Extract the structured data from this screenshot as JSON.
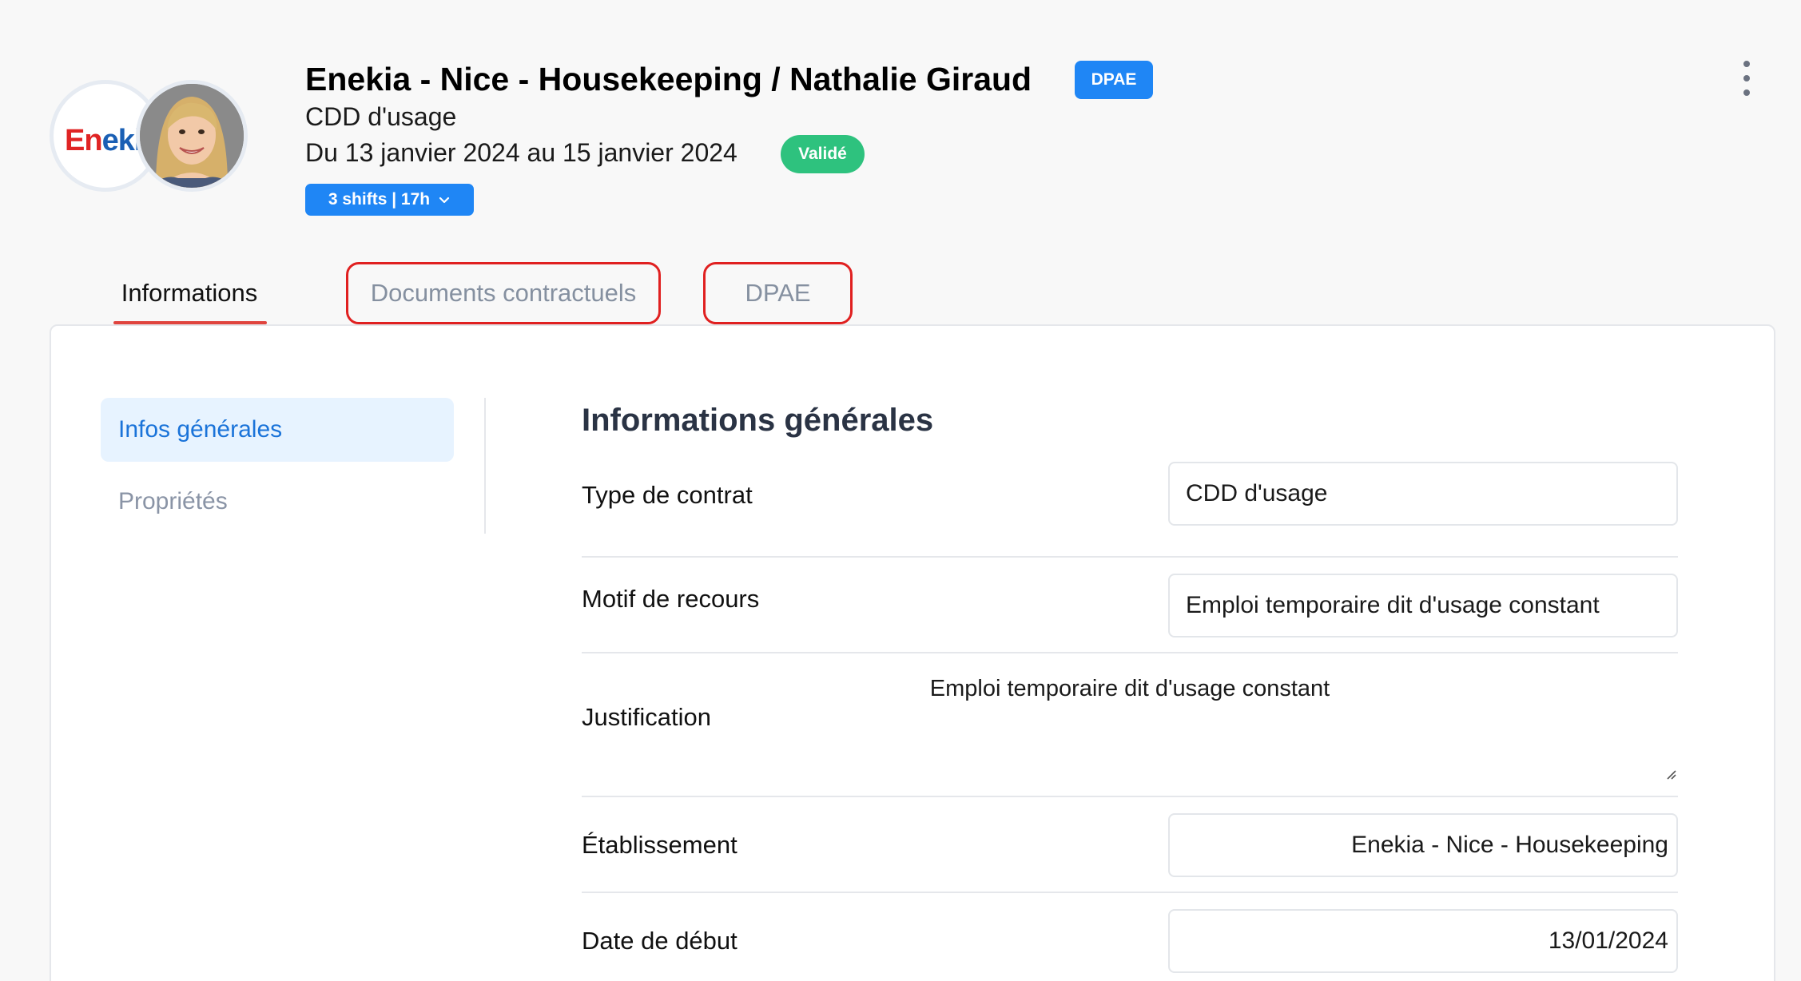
{
  "header": {
    "company_logo_text": "Enekia",
    "title": "Enekia - Nice - Housekeeping / Nathalie Giraud",
    "badge": "DPAE",
    "subtitle": "CDD d'usage",
    "dates": "Du 13 janvier 2024 au 15 janvier 2024",
    "status": "Validé",
    "shifts_label": "3 shifts | 17h"
  },
  "tabs": [
    {
      "label": "Informations",
      "active": true
    },
    {
      "label": "Documents contractuels",
      "active": false
    },
    {
      "label": "DPAE",
      "active": false
    }
  ],
  "sidebar": {
    "items": [
      {
        "label": "Infos générales",
        "active": true
      },
      {
        "label": "Propriétés",
        "active": false
      }
    ]
  },
  "section": {
    "title": "Informations générales",
    "fields": {
      "contract_type": {
        "label": "Type de contrat",
        "value": "CDD d'usage"
      },
      "reason": {
        "label": "Motif de recours",
        "value": "Emploi temporaire dit d'usage constant"
      },
      "justification": {
        "label": "Justification",
        "value": "Emploi temporaire dit d'usage constant"
      },
      "establishment": {
        "label": "Établissement",
        "value": "Enekia - Nice - Housekeeping"
      },
      "start_date": {
        "label": "Date de début",
        "value": "13/01/2024"
      }
    }
  },
  "colors": {
    "accent_blue": "#1f86f5",
    "status_green": "#2ec27e",
    "active_tab_underline": "#e0443e",
    "highlight_red": "#e02020",
    "sidebar_active_bg": "#e7f3ff"
  },
  "icons": {
    "menu": "kebab-vertical-icon",
    "shifts_toggle": "chevron-down-icon",
    "resize": "resize-grip-icon"
  }
}
